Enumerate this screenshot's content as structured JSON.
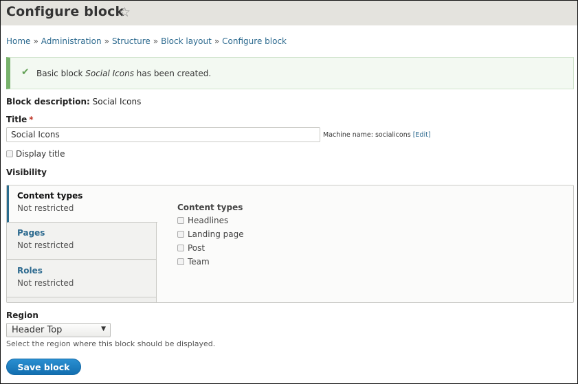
{
  "header": {
    "title": "Configure block",
    "star_icon": "☆"
  },
  "breadcrumb": [
    "Home",
    "Administration",
    "Structure",
    "Block layout",
    "Configure block"
  ],
  "breadcrumb_separator": "»",
  "message": {
    "icon": "✔",
    "prefix": "Basic block ",
    "emphasis": "Social Icons",
    "suffix": " has been created.",
    "colors": {
      "accent": "#77b26b",
      "background": "#f3f9f2"
    }
  },
  "block_description": {
    "label": "Block description:",
    "value": "Social Icons"
  },
  "title_field": {
    "label": "Title",
    "required_mark": "*",
    "value": "Social Icons",
    "machine_name_label": "Machine name: socialicons",
    "edit_link": "[Edit]"
  },
  "display_title": {
    "label": "Display title",
    "checked": false
  },
  "visibility": {
    "label": "Visibility",
    "tabs": [
      {
        "title": "Content types",
        "summary": "Not restricted",
        "active": true
      },
      {
        "title": "Pages",
        "summary": "Not restricted",
        "active": false
      },
      {
        "title": "Roles",
        "summary": "Not restricted",
        "active": false
      }
    ],
    "pane": {
      "title": "Content types",
      "options": [
        {
          "label": "Headlines",
          "checked": false
        },
        {
          "label": "Landing page",
          "checked": false
        },
        {
          "label": "Post",
          "checked": false
        },
        {
          "label": "Team",
          "checked": false
        }
      ]
    }
  },
  "region": {
    "label": "Region",
    "selected": "Header Top",
    "caret": "▼",
    "description": "Select the region where this block should be displayed."
  },
  "save_button": {
    "label": "Save block",
    "color": "#1b7fc2"
  }
}
